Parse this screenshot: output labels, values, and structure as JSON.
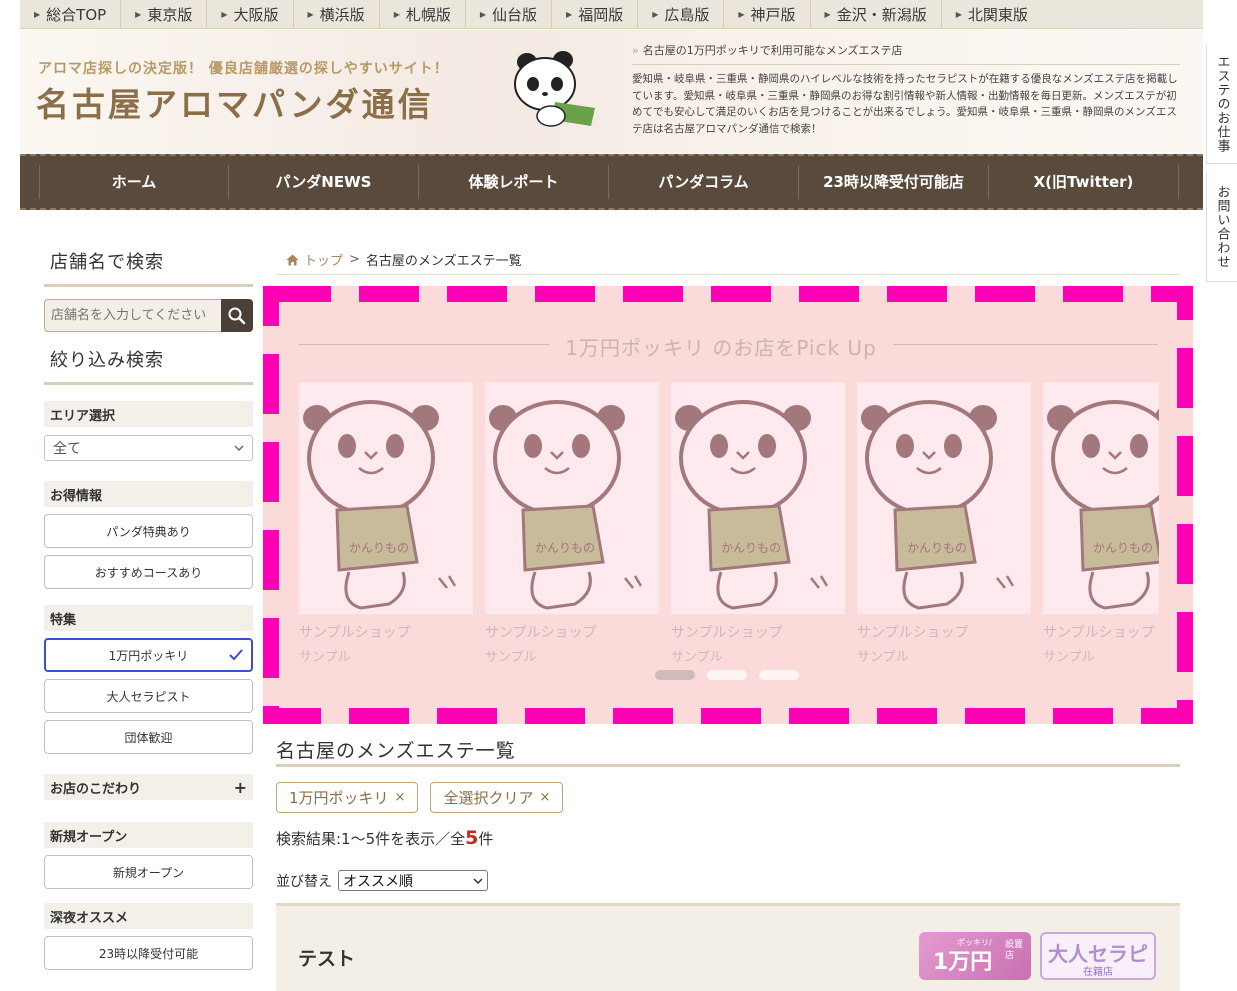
{
  "city_bar": {
    "items": [
      "総合TOP",
      "東京版",
      "大阪版",
      "横浜版",
      "札幌版",
      "仙台版",
      "福岡版",
      "広島版",
      "神戸版",
      "金沢・新潟版",
      "北関東版"
    ]
  },
  "header": {
    "tagline": "アロマ店探しの決定版！ 優良店舗厳選の探しやすいサイト！",
    "site_title": "名古屋アロマパンダ通信",
    "lead": "名古屋の1万円ポッキリで利用可能なメンズエステ店",
    "description": "愛知県・岐阜県・三重県・静岡県のハイレベルな技術を持ったセラピストが在籍する優良なメンズエステ店を掲載しています。愛知県・岐阜県・三重県・静岡県のお得な割引情報や新人情報・出勤情報を毎日更新。メンズエステが初めてでも安心して満足のいくお店を見つけることが出来るでしょう。愛知県・岐阜県・三重県・静岡県のメンズエステ店は名古屋アロマパンダ通信で検索！"
  },
  "nav": {
    "items": [
      "ホーム",
      "パンダNEWS",
      "体験レポート",
      "パンダコラム",
      "23時以降受付可能店",
      "X(旧Twitter)"
    ]
  },
  "side_tabs": {
    "job": "エステのお仕事",
    "contact": "お問い合わせ"
  },
  "sidebar": {
    "search_heading": "店舗名で検索",
    "search_placeholder": "店舗名を入力してください",
    "filter_heading": "絞り込み検索",
    "area": {
      "label": "エリア選択",
      "selected": "全て"
    },
    "deals": {
      "label": "お得情報",
      "options": [
        "パンダ特典あり",
        "おすすめコースあり"
      ]
    },
    "feature": {
      "label": "特集",
      "options": [
        "1万円ポッキリ",
        "大人セラピスト",
        "団体歓迎"
      ],
      "active_index": 0
    },
    "kodawari": {
      "label": "お店のこだわり",
      "toggle": "+"
    },
    "new_open": {
      "label": "新規オープン",
      "options": [
        "新規オープン"
      ]
    },
    "late_night": {
      "label": "深夜オススメ",
      "options": [
        "23時以降受付可能"
      ]
    }
  },
  "breadcrumb": {
    "home": "トップ",
    "separator": ">",
    "current": "名古屋のメンズエステ一覧"
  },
  "pickup": {
    "title": "1万円ポッキリ のお店をPick Up",
    "cards": [
      {
        "name": "サンプルショップ",
        "sub": "サンプル",
        "shirt_text": "かんりもの"
      },
      {
        "name": "サンプルショップ",
        "sub": "サンプル",
        "shirt_text": "かんりもの"
      },
      {
        "name": "サンプルショップ",
        "sub": "サンプル",
        "shirt_text": "かんりもの"
      },
      {
        "name": "サンプルショップ",
        "sub": "サンプル",
        "shirt_text": "かんりもの"
      },
      {
        "name": "サンプルショップ",
        "sub": "サンプル",
        "shirt_text": "かんりもの"
      }
    ],
    "active_dot": 0,
    "dot_count": 3
  },
  "list": {
    "title": "名古屋のメンズエステ一覧",
    "chips": [
      "1万円ポッキリ",
      "全選択クリア"
    ],
    "result_prefix": "検索結果:1〜5件を表示／全",
    "result_total": "5",
    "result_suffix": "件",
    "sort_label": "並び替え",
    "sort_selected": "オススメ順"
  },
  "shop": {
    "name": "テスト",
    "badge1_big": "1万円",
    "badge1_small": "ポッキリ/",
    "badge1_side": "設置店",
    "badge2_big": "大人セラピ",
    "badge2_small": "在籍店"
  },
  "colors": {
    "nav_bg": "#5a4a3c",
    "accent_gold": "#8c6f48",
    "pickup_bg": "#fadbda",
    "dash_magenta": "#ff00b4",
    "active_border": "#3b4fd1",
    "result_red": "#d0241c"
  }
}
